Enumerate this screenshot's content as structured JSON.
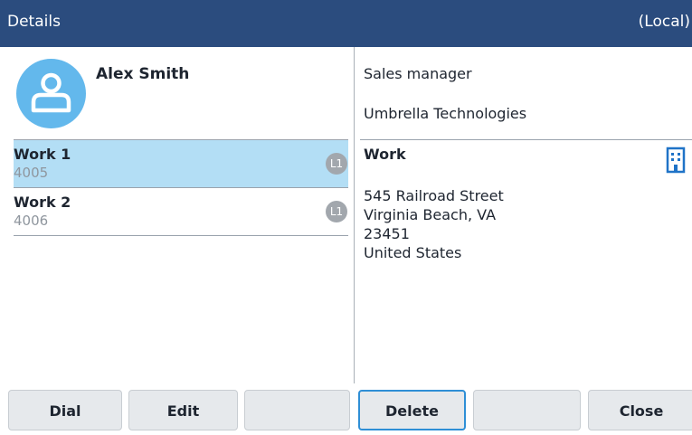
{
  "header": {
    "title": "Details",
    "source": "(Local)"
  },
  "contact": {
    "name": "Alex Smith",
    "job_title": "Sales manager",
    "company": "Umbrella Technologies"
  },
  "numbers": [
    {
      "label": "Work 1",
      "number": "4005",
      "line": "L1",
      "selected": true
    },
    {
      "label": "Work 2",
      "number": "4006",
      "line": "L1",
      "selected": false
    }
  ],
  "address": {
    "label": "Work",
    "street": "545 Railroad Street",
    "city_state": "Virginia Beach, VA",
    "postal_code": "23451",
    "country": "United States"
  },
  "softkeys": {
    "dial": "Dial",
    "edit": "Edit",
    "empty1": "",
    "delete": "Delete",
    "empty2": "",
    "close": "Close"
  },
  "colors": {
    "header_bg": "#2b4c7e",
    "selected_row_bg": "#b3def5",
    "avatar_bg": "#63b8ec",
    "focus_outline": "#2f8fd6",
    "icon_blue": "#1f73c7"
  }
}
